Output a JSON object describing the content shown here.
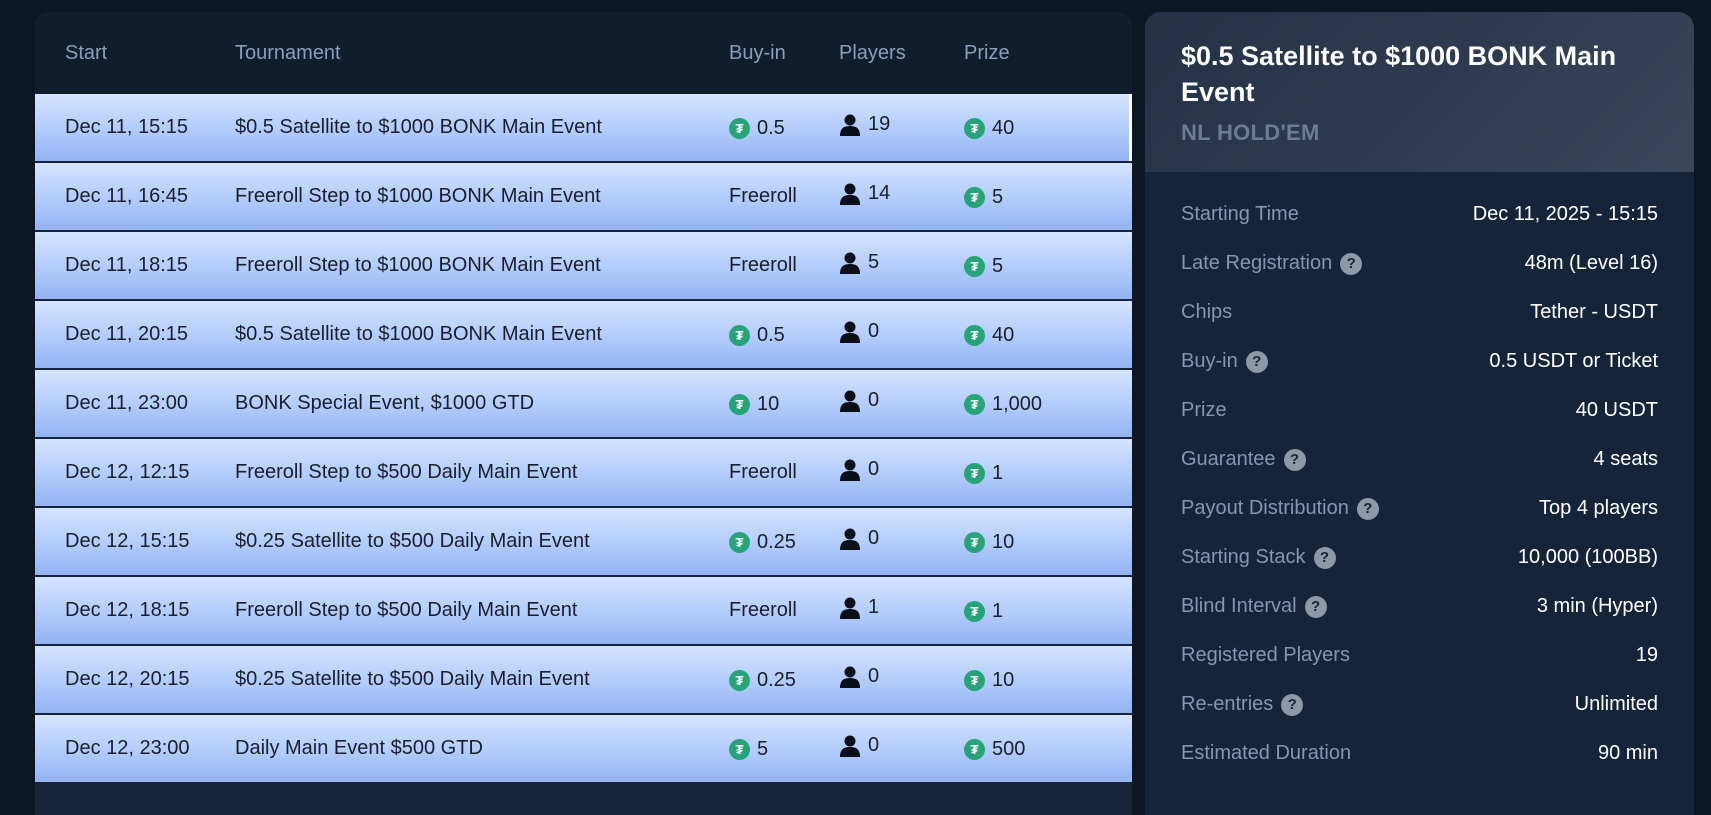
{
  "table": {
    "headers": {
      "start": "Start",
      "tournament": "Tournament",
      "buyin": "Buy-in",
      "players": "Players",
      "prize": "Prize"
    },
    "rows": [
      {
        "start": "Dec 11, 15:15",
        "name": "$0.5 Satellite to $1000 BONK Main Event",
        "buyin": "0.5",
        "buyin_token": true,
        "players": "19",
        "prize": "40",
        "selected": true
      },
      {
        "start": "Dec 11, 16:45",
        "name": "Freeroll Step to $1000 BONK Main Event",
        "buyin": "Freeroll",
        "buyin_token": false,
        "players": "14",
        "prize": "5"
      },
      {
        "start": "Dec 11, 18:15",
        "name": "Freeroll Step to $1000 BONK Main Event",
        "buyin": "Freeroll",
        "buyin_token": false,
        "players": "5",
        "prize": "5"
      },
      {
        "start": "Dec 11, 20:15",
        "name": "$0.5 Satellite to $1000 BONK Main Event",
        "buyin": "0.5",
        "buyin_token": true,
        "players": "0",
        "prize": "40"
      },
      {
        "start": "Dec 11, 23:00",
        "name": "BONK Special Event, $1000 GTD",
        "buyin": "10",
        "buyin_token": true,
        "players": "0",
        "prize": "1,000"
      },
      {
        "start": "Dec 12, 12:15",
        "name": "Freeroll Step to $500 Daily Main Event",
        "buyin": "Freeroll",
        "buyin_token": false,
        "players": "0",
        "prize": "1"
      },
      {
        "start": "Dec 12, 15:15",
        "name": "$0.25 Satellite to $500 Daily Main Event",
        "buyin": "0.25",
        "buyin_token": true,
        "players": "0",
        "prize": "10"
      },
      {
        "start": "Dec 12, 18:15",
        "name": "Freeroll Step to $500 Daily Main Event",
        "buyin": "Freeroll",
        "buyin_token": false,
        "players": "1",
        "prize": "1"
      },
      {
        "start": "Dec 12, 20:15",
        "name": "$0.25 Satellite to $500 Daily Main Event",
        "buyin": "0.25",
        "buyin_token": true,
        "players": "0",
        "prize": "10"
      },
      {
        "start": "Dec 12, 23:00",
        "name": "Daily Main Event $500 GTD",
        "buyin": "5",
        "buyin_token": true,
        "players": "0",
        "prize": "500"
      }
    ]
  },
  "details": {
    "title": "$0.5 Satellite to $1000 BONK Main Event",
    "game": "NL HOLD'EM",
    "items": [
      {
        "label": "Starting Time",
        "value": "Dec 11, 2025 - 15:15",
        "help": false
      },
      {
        "label": "Late Registration",
        "value": "48m (Level 16)",
        "help": true
      },
      {
        "label": "Chips",
        "value": "Tether - USDT",
        "help": false
      },
      {
        "label": "Buy-in",
        "value": "0.5 USDT or Ticket",
        "help": true
      },
      {
        "label": "Prize",
        "value": "40 USDT",
        "help": false
      },
      {
        "label": "Guarantee",
        "value": "4 seats",
        "help": true
      },
      {
        "label": "Payout Distribution",
        "value": "Top 4 players",
        "help": true
      },
      {
        "label": "Starting Stack",
        "value": "10,000 (100BB)",
        "help": true
      },
      {
        "label": "Blind Interval",
        "value": "3 min (Hyper)",
        "help": true
      },
      {
        "label": "Registered Players",
        "value": "19",
        "help": false
      },
      {
        "label": "Re-entries",
        "value": "Unlimited",
        "help": true
      },
      {
        "label": "Estimated Duration",
        "value": "90 min",
        "help": false
      }
    ]
  },
  "icons": {
    "token": "tether-token-icon",
    "player": "person-icon",
    "help": "question-mark-icon"
  },
  "colors": {
    "token": "#27a37a",
    "row_top": "#d5e4ff",
    "row_bottom": "#93b3f2",
    "background": "#0c1624"
  }
}
